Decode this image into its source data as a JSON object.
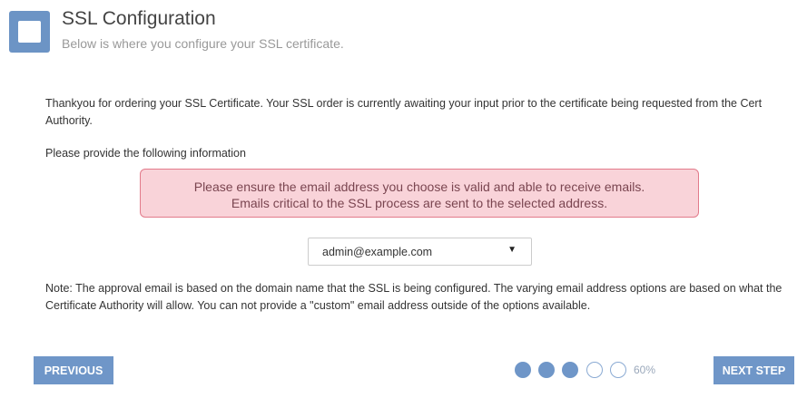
{
  "header": {
    "title": "SSL Configuration",
    "subtitle": "Below is where you configure your SSL certificate.",
    "icon": "square-icon",
    "icon_color": "#6c94c5"
  },
  "content": {
    "intro": "Thankyou for ordering your SSL Certificate. Your SSL order is currently awaiting your input prior to the certificate being requested from the Cert Authority.",
    "prompt": "Please provide the following information",
    "alert": {
      "line1": "Please ensure the email address you choose is valid and able to receive emails.",
      "line2": "Emails critical to the SSL process are sent to the selected address.",
      "background": "#f9d3d9",
      "border": "#e27b8b"
    },
    "email_select": {
      "selected": "admin@example.com",
      "caret": "▼"
    },
    "note": "Note: The approval email is based on the domain name that the SSL is being configured. The varying email address options are based on what the Certificate Authority will allow. You can not provide a \"custom\" email address outside of the options available."
  },
  "footer": {
    "previous_label": "PREVIOUS",
    "next_label": "NEXT STEP",
    "button_color": "#6f96c8",
    "progress": {
      "steps": [
        true,
        true,
        true,
        false,
        false
      ],
      "percent_label": "60%",
      "percent": 60
    }
  }
}
